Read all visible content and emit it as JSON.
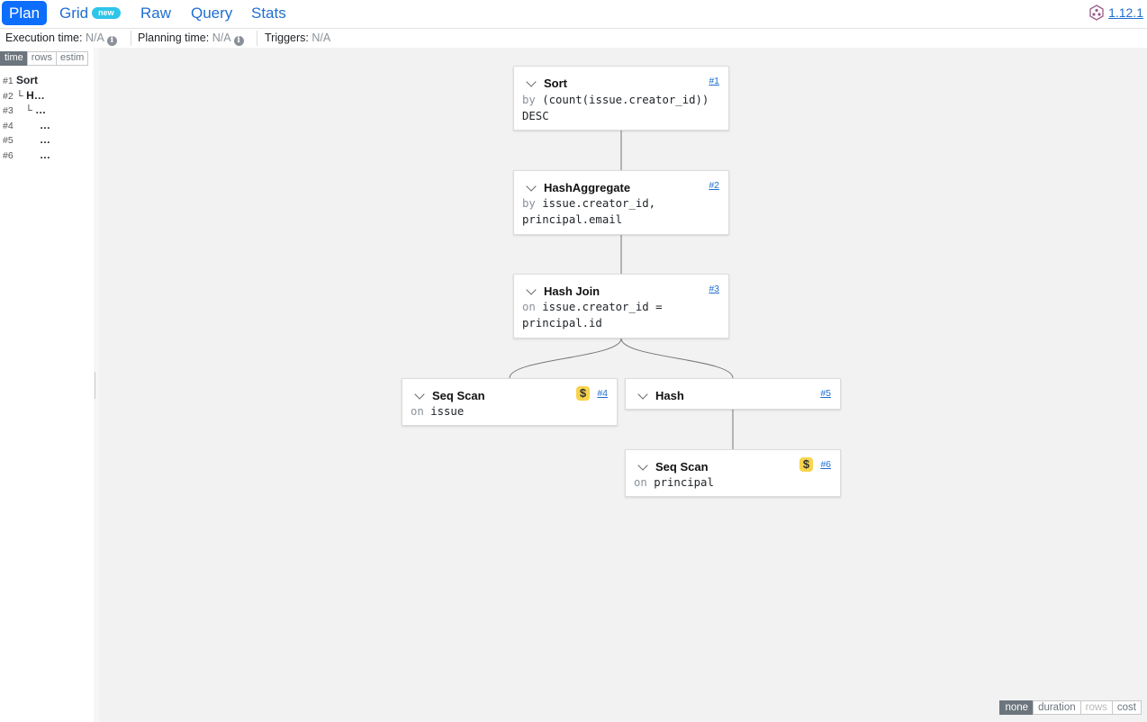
{
  "nav": {
    "tabs": [
      {
        "label": "Plan",
        "active": true
      },
      {
        "label": "Grid",
        "badge": "new"
      },
      {
        "label": "Raw"
      },
      {
        "label": "Query"
      },
      {
        "label": "Stats"
      }
    ],
    "version": "1.12.1"
  },
  "stats": {
    "execution_label": "Execution time:",
    "execution_value": "N/A",
    "planning_label": "Planning time:",
    "planning_value": "N/A",
    "triggers_label": "Triggers:",
    "triggers_value": "N/A"
  },
  "sidebar": {
    "segments": [
      "time",
      "rows",
      "estim"
    ],
    "active_segment": "time",
    "tree": [
      {
        "num": "#1",
        "prefix": "",
        "name": "Sort"
      },
      {
        "num": "#2",
        "prefix": "└",
        "name": "H…"
      },
      {
        "num": "#3",
        "prefix": "└",
        "name": "…"
      },
      {
        "num": "#4",
        "prefix": "",
        "name": "…"
      },
      {
        "num": "#5",
        "prefix": "",
        "name": "…"
      },
      {
        "num": "#6",
        "prefix": "",
        "name": "…"
      }
    ]
  },
  "plan": {
    "nodes": [
      {
        "id": "#1",
        "name": "Sort",
        "key": "by",
        "detail_1": "(count(issue.creator_id))",
        "detail_2": "DESC",
        "cost_flag": false
      },
      {
        "id": "#2",
        "name": "HashAggregate",
        "key": "by",
        "detail_1": "issue.creator_id,",
        "detail_2": "principal.email",
        "cost_flag": false
      },
      {
        "id": "#3",
        "name": "Hash Join",
        "key": "on",
        "detail_1": "issue.creator_id =",
        "detail_2": "principal.id",
        "cost_flag": false
      },
      {
        "id": "#4",
        "name": "Seq Scan",
        "key": "on",
        "detail_1": "issue",
        "cost_flag": true,
        "cost_symbol": "$"
      },
      {
        "id": "#5",
        "name": "Hash",
        "cost_flag": false
      },
      {
        "id": "#6",
        "name": "Seq Scan",
        "key": "on",
        "detail_1": "principal",
        "cost_flag": true,
        "cost_symbol": "$"
      }
    ]
  },
  "highlight": {
    "options": [
      "none",
      "duration",
      "rows",
      "cost"
    ],
    "active": "none",
    "disabled": [
      "rows"
    ]
  },
  "colors": {
    "accent": "#0d6efd",
    "link": "#1f6fd1",
    "badge": "#2ec5e8",
    "cost_badge": "#f7d44c",
    "canvas_bg": "#f2f2f2"
  },
  "icons": {
    "info": "info-icon",
    "version_logo": "logo-icon",
    "collapse": "chevron-down-icon"
  }
}
